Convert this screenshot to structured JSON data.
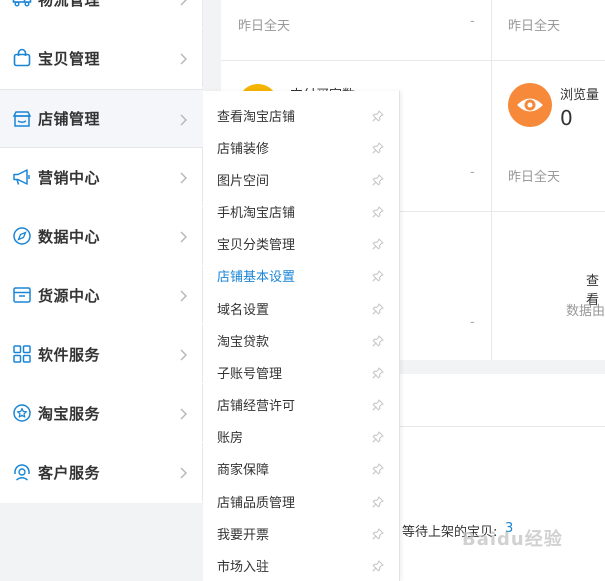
{
  "sidebar": {
    "items": [
      {
        "label": "物流管理",
        "icon": "truck-icon"
      },
      {
        "label": "宝贝管理",
        "icon": "shopping-bag-icon"
      },
      {
        "label": "店铺管理",
        "icon": "storefront-icon"
      },
      {
        "label": "营销中心",
        "icon": "megaphone-icon"
      },
      {
        "label": "数据中心",
        "icon": "compass-icon"
      },
      {
        "label": "货源中心",
        "icon": "archive-box-icon"
      },
      {
        "label": "软件服务",
        "icon": "app-grid-icon"
      },
      {
        "label": "淘宝服务",
        "icon": "star-badge-icon"
      },
      {
        "label": "客户服务",
        "icon": "headset-icon"
      }
    ]
  },
  "flyout": {
    "items": [
      {
        "label": "查看淘宝店铺"
      },
      {
        "label": "店铺装修"
      },
      {
        "label": "图片空间"
      },
      {
        "label": "手机淘宝店铺"
      },
      {
        "label": "宝贝分类管理"
      },
      {
        "label": "店铺基本设置"
      },
      {
        "label": "域名设置"
      },
      {
        "label": "淘宝贷款"
      },
      {
        "label": "子账号管理"
      },
      {
        "label": "店铺经营许可"
      },
      {
        "label": "账房"
      },
      {
        "label": "商家保障"
      },
      {
        "label": "店铺品质管理"
      },
      {
        "label": "我要开票"
      },
      {
        "label": "市场入驻"
      }
    ]
  },
  "stats": {
    "yesterday_1": "昨日全天",
    "yesterday_2": "昨日全天",
    "yesterday_3": "昨日全天",
    "dash_1": "-",
    "dash_2": "-",
    "dash_3": "-",
    "partial_metric": "支付买家数",
    "views_label": "浏览量",
    "views_value": "0",
    "view_more": "查看",
    "data_from": "数据由",
    "pending_label": "等待上架的宝贝:",
    "pending_value": "3"
  },
  "watermark": "Baidu经验",
  "colors": {
    "accent_blue": "#1a85d6",
    "eye_orange": "#f7893a",
    "partial_yellow": "#f6b400"
  }
}
